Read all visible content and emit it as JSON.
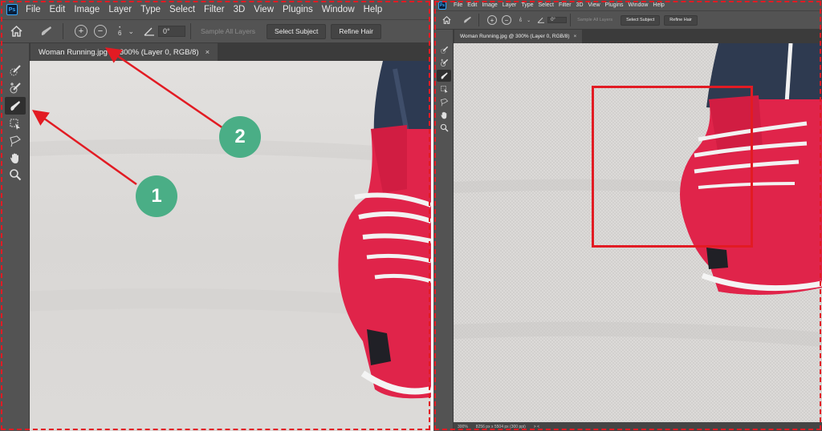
{
  "app": {
    "logo_text": "Ps"
  },
  "menu": [
    "File",
    "Edit",
    "Image",
    "Layer",
    "Type",
    "Select",
    "Filter",
    "3D",
    "View",
    "Plugins",
    "Window",
    "Help"
  ],
  "options_bar": {
    "brush_size": "6",
    "angle_value": "0°",
    "sample_all_layers_label": "Sample All Layers",
    "select_subject_label": "Select Subject",
    "refine_hair_label": "Refine Hair"
  },
  "document_tab": {
    "title": "Woman Running.jpg @ 300% (Layer 0, RGB/8)",
    "close_glyph": "×"
  },
  "status_bar": {
    "zoom": "300%",
    "dimensions": "8256 px x 5504 px (300 ppi)",
    "nav_arrows": ">  <"
  },
  "annotations": {
    "marker_1": "1",
    "marker_2": "2",
    "arrow_color": "#e21b23",
    "marker_color": "#4aae86"
  },
  "tools": [
    "quick-selection-tool",
    "quick-selection-add-tool",
    "refine-edge-brush-tool",
    "object-selection-tool",
    "lasso-tool",
    "hand-tool",
    "zoom-tool"
  ],
  "colors": {
    "ui_bg": "#535353",
    "canvas_bg": "#dedcda",
    "shoe_red": "#e0244a"
  }
}
